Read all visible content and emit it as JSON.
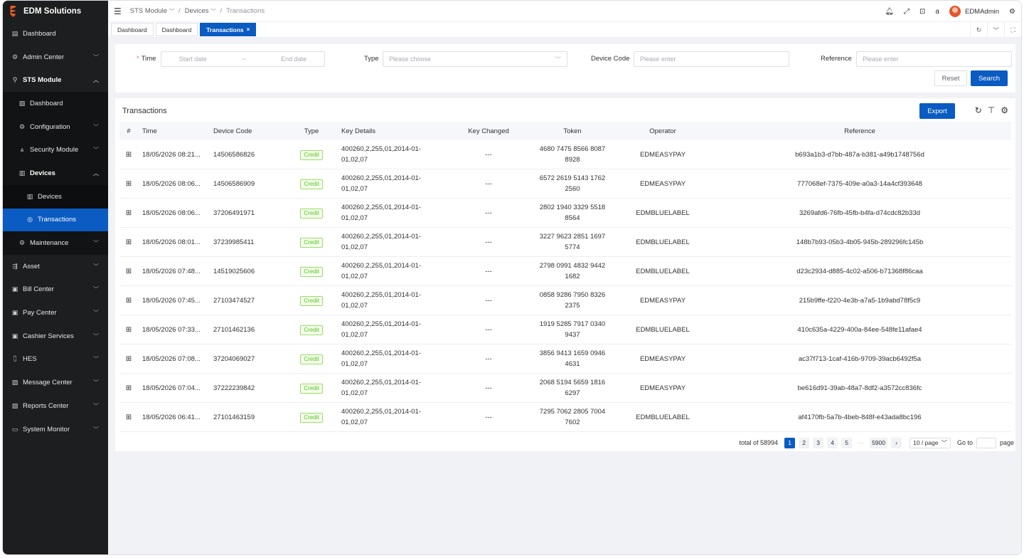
{
  "brand": {
    "title": "EDM Solutions"
  },
  "sidebar": {
    "items": [
      {
        "label": "Dashboard",
        "icon": "calendar-icon"
      },
      {
        "label": "Admin Center",
        "icon": "gear-icon"
      },
      {
        "label": "STS Module",
        "icon": "key-icon"
      },
      {
        "label": "Dashboard",
        "icon": "chart-icon"
      },
      {
        "label": "Configuration",
        "icon": "gear-icon"
      },
      {
        "label": "Security Module",
        "icon": "network-icon"
      },
      {
        "label": "Devices",
        "icon": "device-icon"
      },
      {
        "label": "Devices",
        "icon": "device-icon"
      },
      {
        "label": "Transactions",
        "icon": "coin-icon"
      },
      {
        "label": "Maintenance",
        "icon": "gear-icon"
      },
      {
        "label": "Asset",
        "icon": "asset-icon"
      },
      {
        "label": "Bill Center",
        "icon": "bill-icon"
      },
      {
        "label": "Pay Center",
        "icon": "pay-icon"
      },
      {
        "label": "Cashier Services",
        "icon": "cashier-icon"
      },
      {
        "label": "HES",
        "icon": "hierarchy-icon"
      },
      {
        "label": "Message Center",
        "icon": "message-icon"
      },
      {
        "label": "Reports Center",
        "icon": "report-icon"
      },
      {
        "label": "System Monitor",
        "icon": "monitor-icon"
      }
    ]
  },
  "header": {
    "breadcrumb": [
      "STS Module",
      "Devices",
      "Transactions"
    ],
    "username": "EDMAdmin"
  },
  "tabs": [
    {
      "label": "Dashboard"
    },
    {
      "label": "Dashboard"
    },
    {
      "label": "Transactions"
    }
  ],
  "search": {
    "time_label": "Time",
    "start_placeholder": "Start date",
    "range_sep": "~",
    "end_placeholder": "End date",
    "type_label": "Type",
    "type_placeholder": "Please choose",
    "device_code_label": "Device Code",
    "device_code_placeholder": "Please enter",
    "reference_label": "Reference",
    "reference_placeholder": "Please enter",
    "reset_label": "Reset",
    "search_label": "Search"
  },
  "table": {
    "title": "Transactions",
    "export_label": "Export",
    "columns": [
      "#",
      "Time",
      "Device Code",
      "Type",
      "Key Details",
      "Key Changed",
      "Token",
      "Operator",
      "Reference"
    ],
    "rows": [
      {
        "time": "18/05/2026 08:21...",
        "device_code": "14506586826",
        "type": "Credit",
        "key_details_1": "400260,2,255,01,2014-01-",
        "key_details_2": "01,02,07",
        "key_changed": "---",
        "token_1": "4680 7475 8566 8087",
        "token_2": "8928",
        "operator": "EDMEASYPAY",
        "reference": "b693a1b3-d7bb-487a-b381-a49b1748756d"
      },
      {
        "time": "18/05/2026 08:06...",
        "device_code": "14506586909",
        "type": "Credit",
        "key_details_1": "400260,2,255,01,2014-01-",
        "key_details_2": "01,02,07",
        "key_changed": "---",
        "token_1": "6572 2619 5143 1762",
        "token_2": "2560",
        "operator": "EDMEASYPAY",
        "reference": "777068ef-7375-409e-a0a3-14a4cf393648"
      },
      {
        "time": "18/05/2026 08:06...",
        "device_code": "37206491971",
        "type": "Credit",
        "key_details_1": "400260,2,255,01,2014-01-",
        "key_details_2": "01,02,07",
        "key_changed": "---",
        "token_1": "2802 1940 3329 5518",
        "token_2": "8564",
        "operator": "EDMBLUELABEL",
        "reference": "3269afd6-76fb-45fb-b4fa-d74cdc82b33d"
      },
      {
        "time": "18/05/2026 08:01...",
        "device_code": "37239985411",
        "type": "Credit",
        "key_details_1": "400260,2,255,01,2014-01-",
        "key_details_2": "01,02,07",
        "key_changed": "---",
        "token_1": "3227 9623 2851 1697",
        "token_2": "5774",
        "operator": "EDMBLUELABEL",
        "reference": "148b7b93-05b3-4b05-945b-289296fc145b"
      },
      {
        "time": "18/05/2026 07:48...",
        "device_code": "14519025606",
        "type": "Credit",
        "key_details_1": "400260,2,255,01,2014-01-",
        "key_details_2": "01,02,07",
        "key_changed": "---",
        "token_1": "2798 0991 4832 9442",
        "token_2": "1682",
        "operator": "EDMBLUELABEL",
        "reference": "d23c2934-d885-4c02-a506-b71368f86caa"
      },
      {
        "time": "18/05/2026 07:45...",
        "device_code": "27103474527",
        "type": "Credit",
        "key_details_1": "400260,2,255,01,2014-01-",
        "key_details_2": "01,02,07",
        "key_changed": "---",
        "token_1": "0858 9286 7950 8326",
        "token_2": "2375",
        "operator": "EDMEASYPAY",
        "reference": "215b9ffe-f220-4e3b-a7a5-1b9abd78f5c9"
      },
      {
        "time": "18/05/2026 07:33...",
        "device_code": "27101462136",
        "type": "Credit",
        "key_details_1": "400260,2,255,01,2014-01-",
        "key_details_2": "01,02,07",
        "key_changed": "---",
        "token_1": "1919 5285 7917 0340",
        "token_2": "9437",
        "operator": "EDMBLUELABEL",
        "reference": "410c635a-4229-400a-84ee-548fe11afae4"
      },
      {
        "time": "18/05/2026 07:08...",
        "device_code": "37204069027",
        "type": "Credit",
        "key_details_1": "400260,2,255,01,2014-01-",
        "key_details_2": "01,02,07",
        "key_changed": "---",
        "token_1": "3856 9413 1659 0946",
        "token_2": "4631",
        "operator": "EDMEASYPAY",
        "reference": "ac37f713-1caf-416b-9709-39acb6492f5a"
      },
      {
        "time": "18/05/2026 07:04...",
        "device_code": "37222239842",
        "type": "Credit",
        "key_details_1": "400260,2,255,01,2014-01-",
        "key_details_2": "01,02,07",
        "key_changed": "---",
        "token_1": "2068 5194 5659 1816",
        "token_2": "6297",
        "operator": "EDMEASYPAY",
        "reference": "be616d91-39ab-48a7-8df2-a3572cc836fc"
      },
      {
        "time": "18/05/2026 06:41...",
        "device_code": "27101463159",
        "type": "Credit",
        "key_details_1": "400260,2,255,01,2014-01-",
        "key_details_2": "01,02,07",
        "key_changed": "---",
        "token_1": "7295 7062 2805 7004",
        "token_2": "7602",
        "operator": "EDMBLUELABEL",
        "reference": "af4170fb-5a7b-4beb-848f-e43ada8bc196"
      }
    ]
  },
  "pagination": {
    "total_text": "total of 58994",
    "pages": [
      "1",
      "2",
      "3",
      "4",
      "5"
    ],
    "ellipsis": "···",
    "last_page": "5900",
    "page_size": "10 / page",
    "goto_label": "Go to",
    "page_suffix": "page"
  },
  "colors": {
    "primary": "#0a5bc2",
    "sidebar_bg": "#1d1e1f",
    "credit_green": "#52c41a"
  }
}
